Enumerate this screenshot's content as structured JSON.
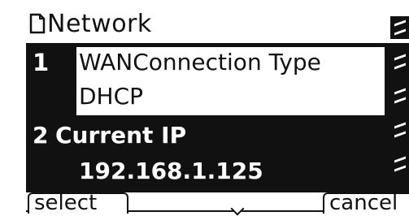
{
  "header": {
    "title": "Network",
    "icon": "document-icon"
  },
  "menu": {
    "items": [
      {
        "index": "1",
        "label": "WANConnection Type",
        "value": "DHCP",
        "selected": true
      },
      {
        "index": "2",
        "label": "Current IP",
        "value": "192.168.1.125",
        "selected": false
      }
    ]
  },
  "softkeys": {
    "left": "select",
    "right": "cancel"
  }
}
